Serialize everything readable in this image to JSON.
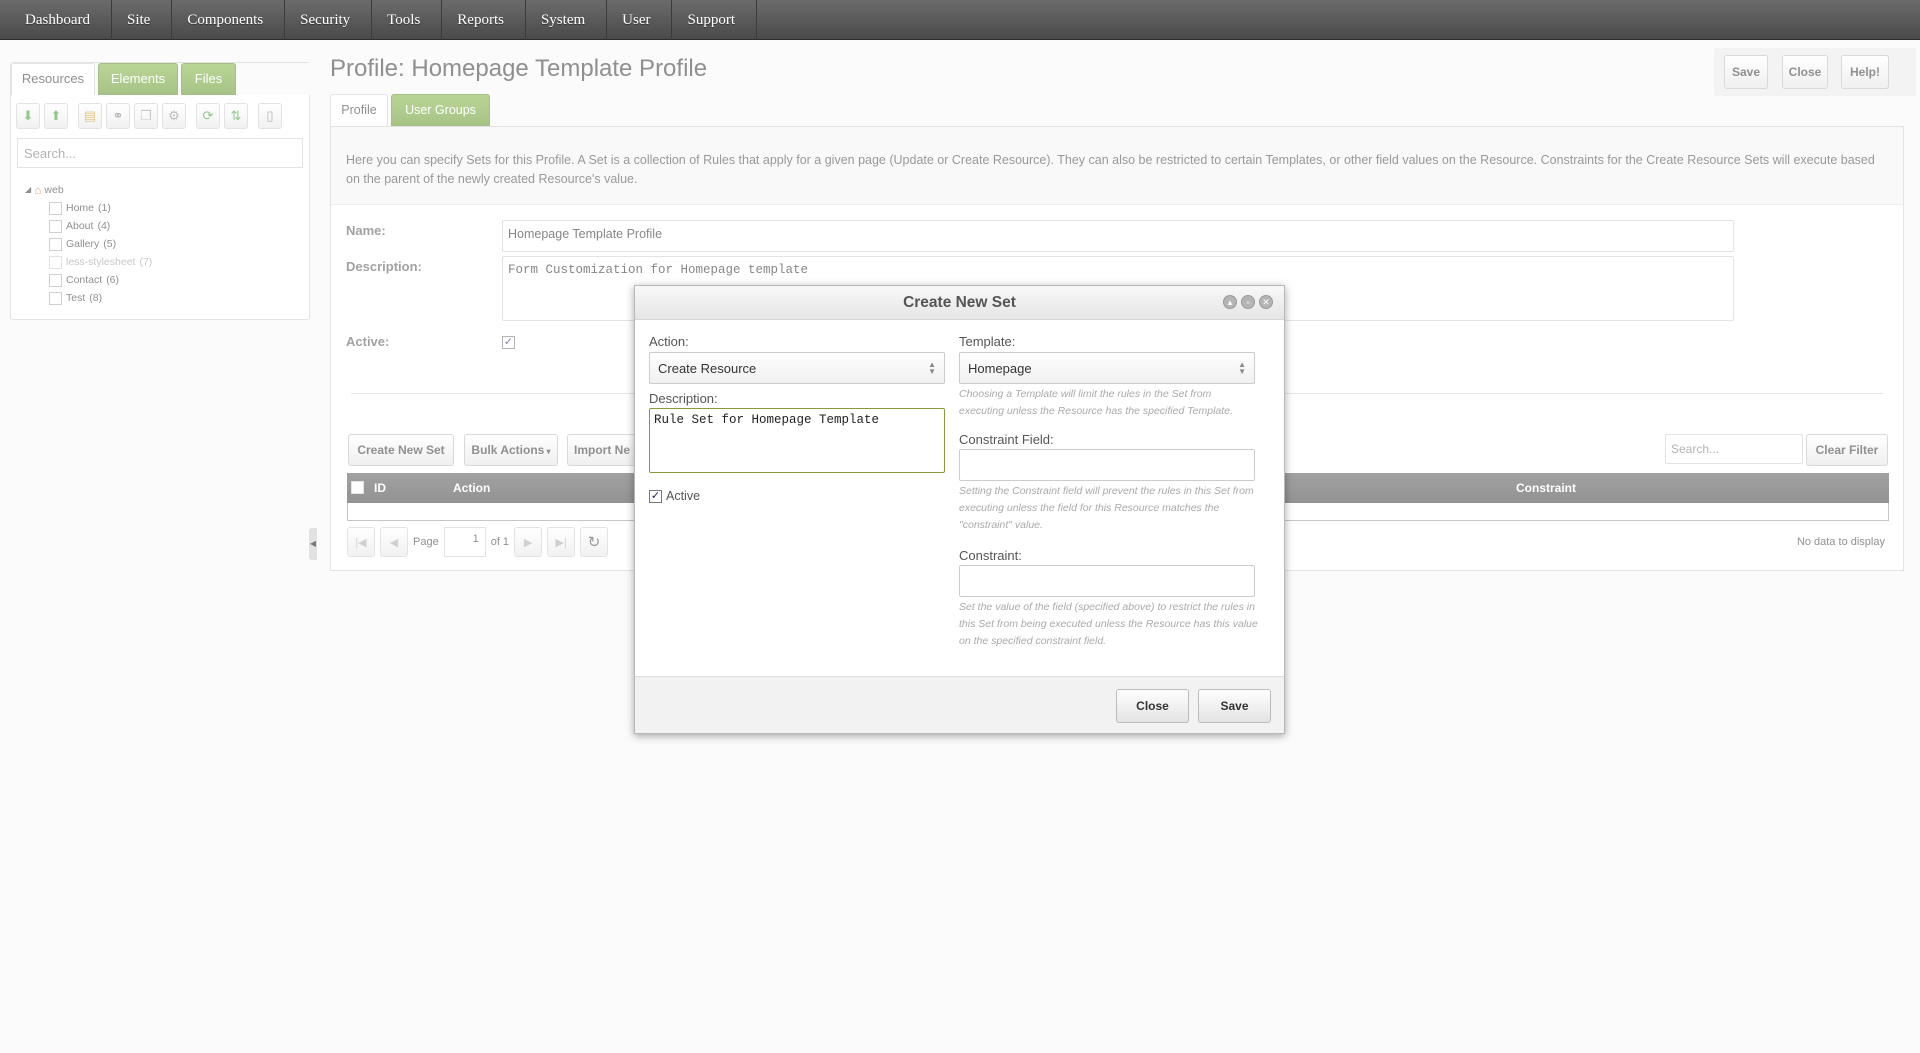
{
  "nav": {
    "items": [
      {
        "label": "Dashboard"
      },
      {
        "label": "Site"
      },
      {
        "label": "Components"
      },
      {
        "label": "Security"
      },
      {
        "label": "Tools"
      },
      {
        "label": "Reports"
      },
      {
        "label": "System"
      },
      {
        "label": "User"
      },
      {
        "label": "Support"
      }
    ]
  },
  "left": {
    "tabs": {
      "resources": "Resources",
      "elements": "Elements",
      "files": "Files"
    },
    "search_placeholder": "Search...",
    "tree": {
      "root": "web",
      "items": [
        {
          "label": "Home",
          "count": "(1)"
        },
        {
          "label": "About",
          "count": "(4)"
        },
        {
          "label": "Gallery",
          "count": "(5)"
        },
        {
          "label": "less-stylesheet",
          "count": "(7)"
        },
        {
          "label": "Contact",
          "count": "(6)"
        },
        {
          "label": "Test",
          "count": "(8)"
        }
      ]
    }
  },
  "page": {
    "title": "Profile: Homepage Template Profile",
    "buttons": {
      "save": "Save",
      "close": "Close",
      "help": "Help!"
    },
    "tabs": {
      "profile": "Profile",
      "user_groups": "User Groups"
    },
    "intro": "Here you can specify Sets for this Profile. A Set is a collection of Rules that apply for a given page (Update or Create Resource). They can also be restricted to certain Templates, or other field values on the Resource. Constraints for the Create Resource Sets will execute based on the parent of the newly created Resource's value.",
    "form": {
      "name_label": "Name:",
      "name_value": "Homepage Template Profile",
      "description_label": "Description:",
      "description_value": "Form Customization for Homepage template",
      "active_label": "Active:",
      "active_check": "✓"
    },
    "grid": {
      "create_button": "Create New Set",
      "bulk_button": "Bulk Actions",
      "import_button": "Import Ne",
      "search_placeholder": "Search...",
      "clear_button": "Clear Filter",
      "columns": {
        "id": "ID",
        "action": "Action",
        "constraint": "Constraint"
      },
      "page_label": "Page",
      "page_value": "1",
      "of_label": "of 1",
      "empty_text": "No data to display"
    }
  },
  "modal": {
    "title": "Create New Set",
    "action_label": "Action:",
    "action_value": "Create Resource",
    "template_label": "Template:",
    "template_value": "Homepage",
    "template_hint": "Choosing a Template will limit the rules in the Set from executing unless the Resource has the specified Template.",
    "description_label": "Description:",
    "description_value": "Rule Set for Homepage Template",
    "active_label": "Active",
    "active_check": "✓",
    "constraint_field_label": "Constraint Field:",
    "constraint_field_hint": "Setting the Constraint field will prevent the rules in this Set from executing unless the field for this Resource matches the \"constraint\" value.",
    "constraint_label": "Constraint:",
    "constraint_hint": "Set the value of the field (specified above) to restrict the rules in this Set from being executed unless the Resource has this value on the specified constraint field.",
    "close_button": "Close",
    "save_button": "Save"
  },
  "colors": {
    "accent_green": "#6aa22f",
    "nav_bg": "#555555",
    "grid_header": "#444444"
  }
}
